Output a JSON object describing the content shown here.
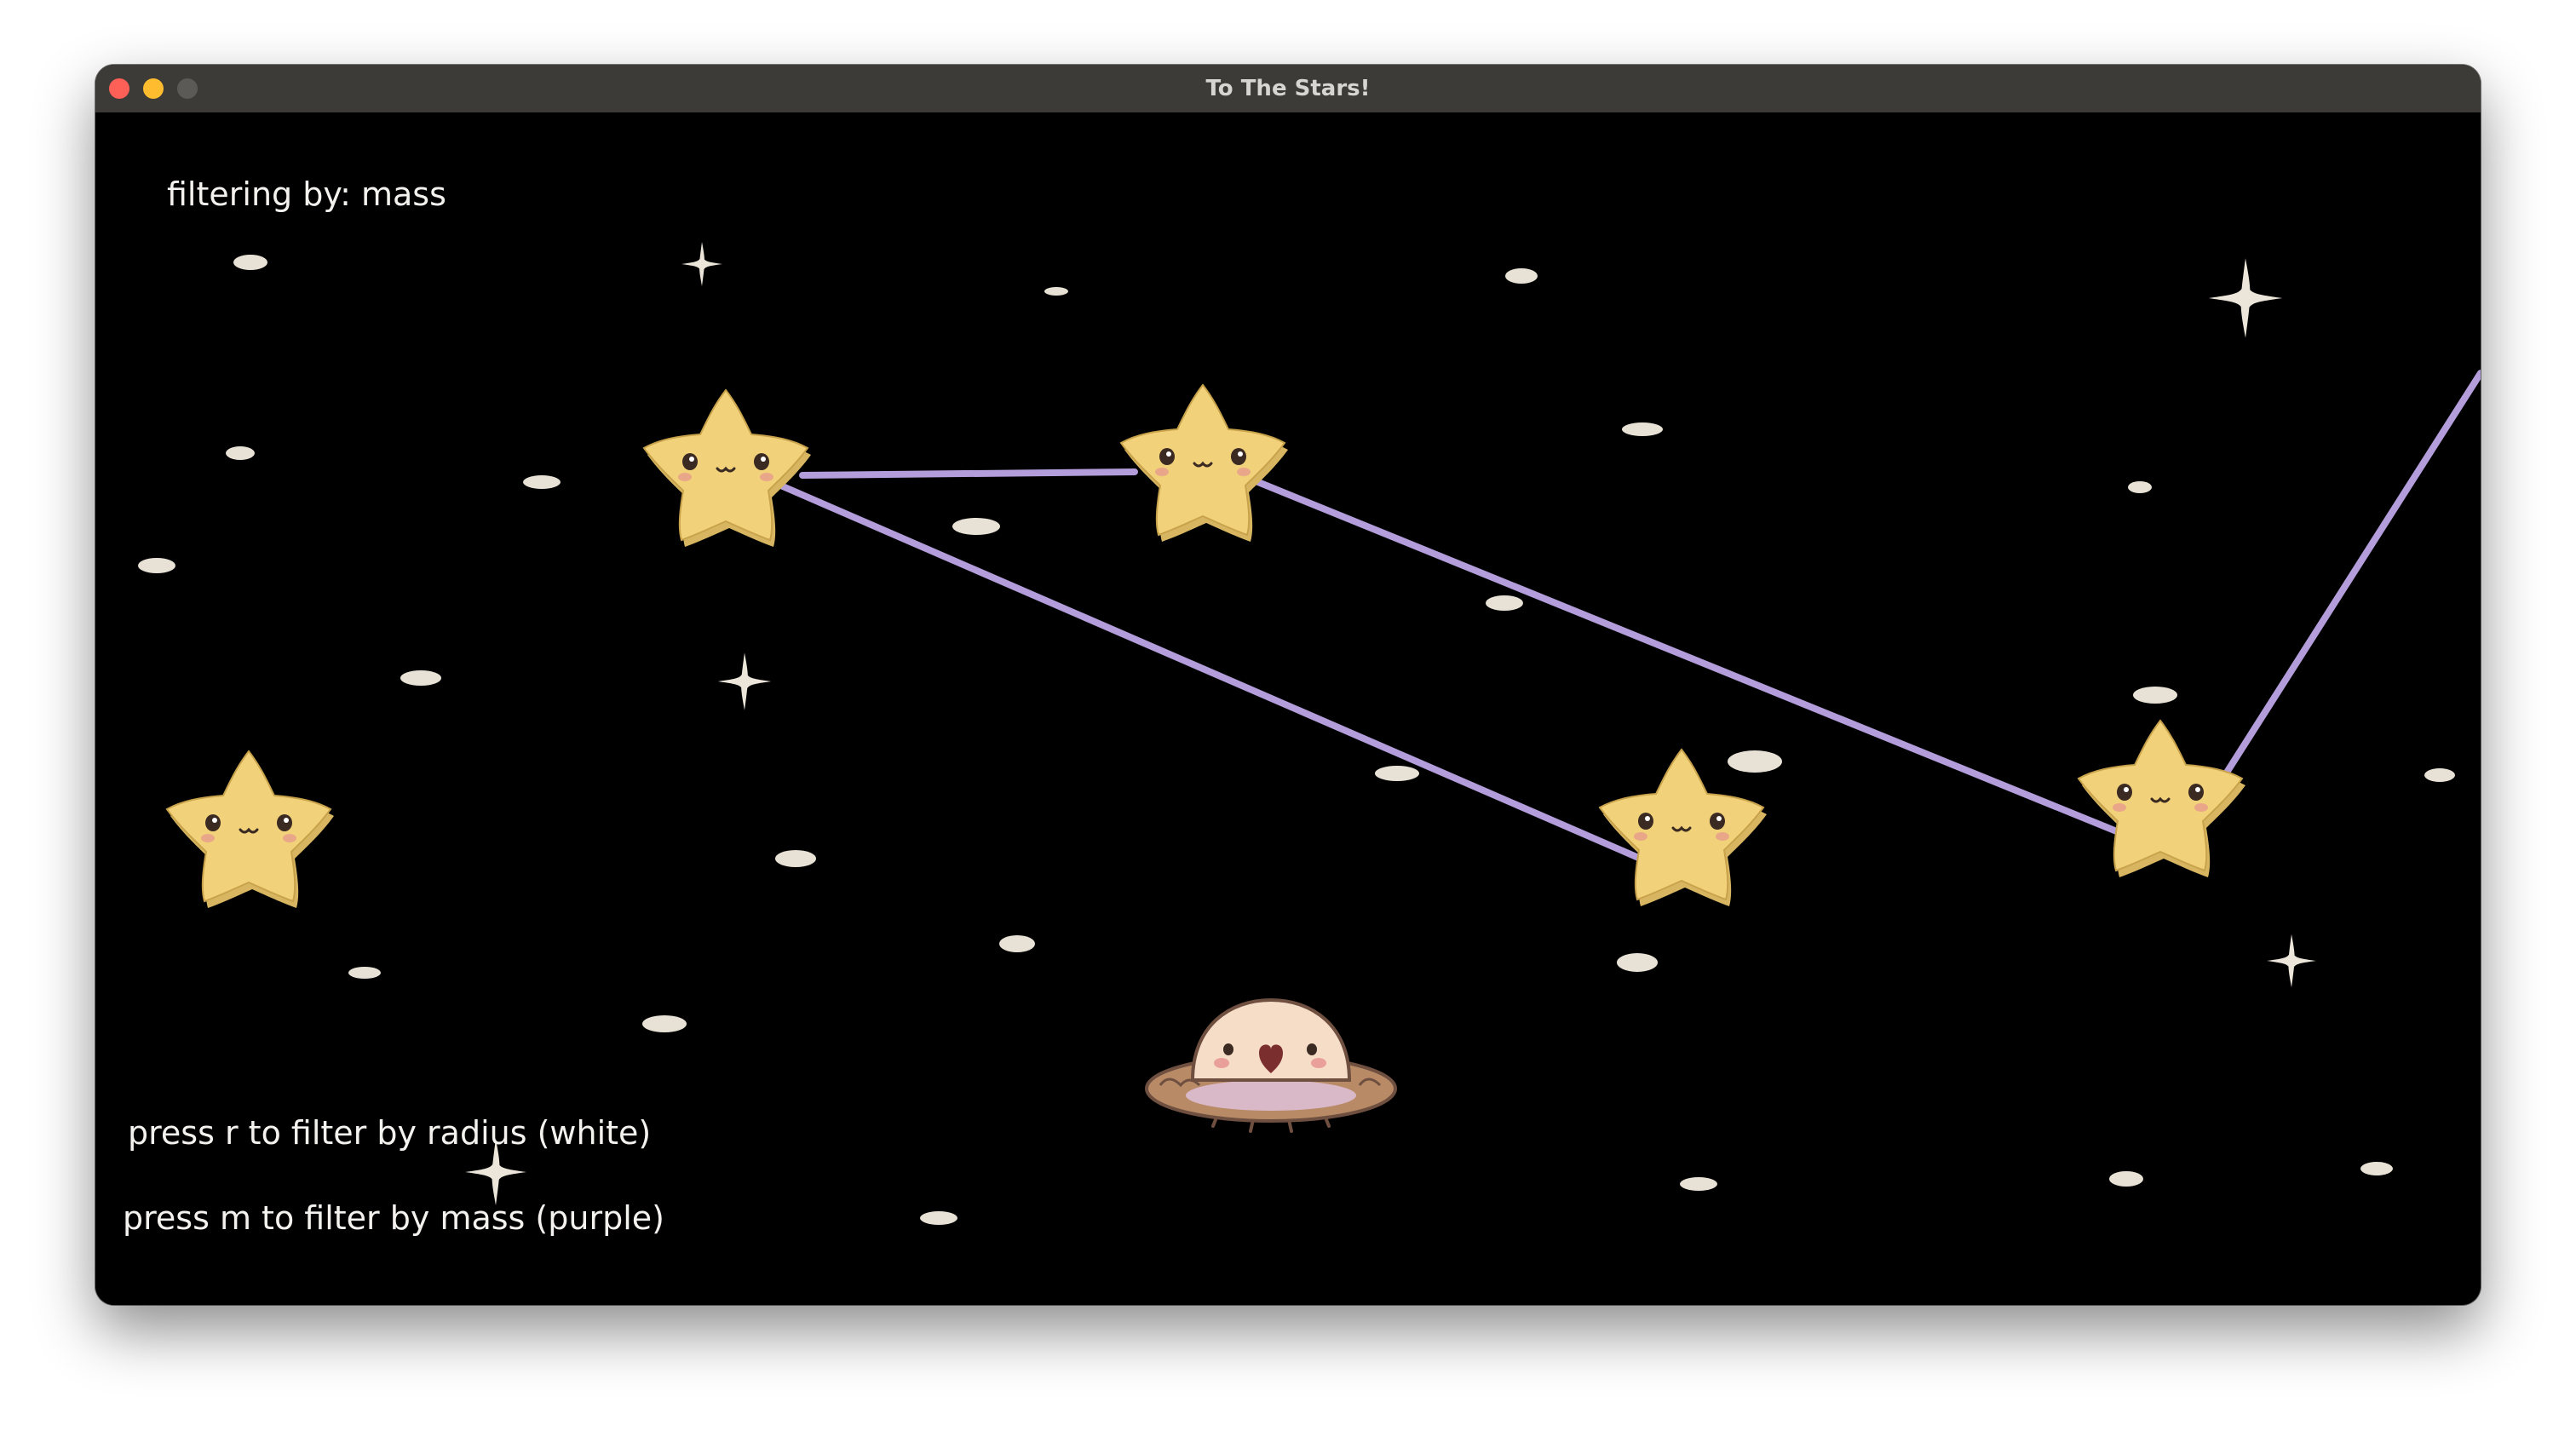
{
  "window": {
    "title": "To The Stars!"
  },
  "hud": {
    "filter_status": "filtering by: mass",
    "hint_radius": "press r to filter by radius (white)",
    "hint_mass": "press m to filter by mass (purple)"
  },
  "colors": {
    "background": "#000000",
    "star_fill": "#f1d27a",
    "edge_mass": "#b39ddb",
    "dust": "#e8e2d6"
  },
  "icons": {
    "star": "kawaii-star-icon",
    "player": "ufo-spaceship-icon"
  }
}
